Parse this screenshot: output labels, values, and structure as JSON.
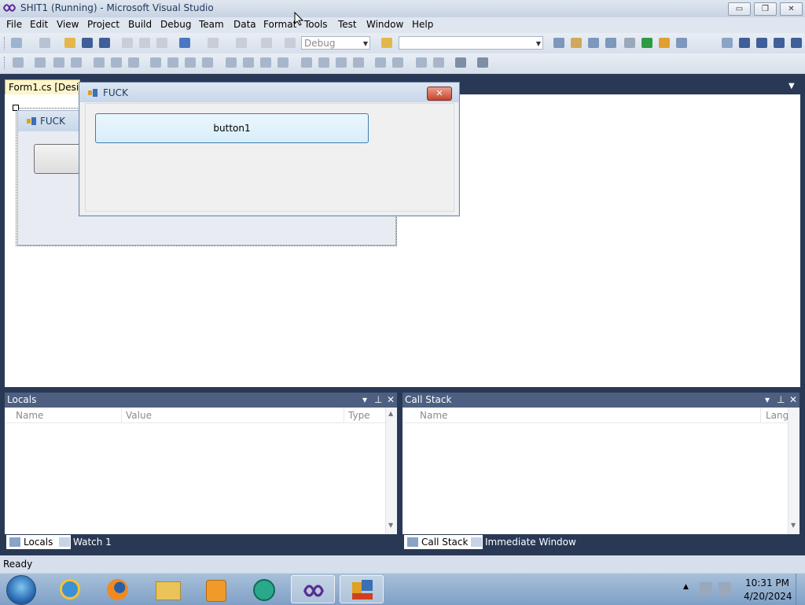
{
  "window": {
    "title": "SHIT1 (Running) - Microsoft Visual Studio",
    "min_glyph": "▭",
    "restore_glyph": "❐",
    "close_glyph": "✕"
  },
  "menu": [
    "File",
    "Edit",
    "View",
    "Project",
    "Build",
    "Debug",
    "Team",
    "Data",
    "Format",
    "Tools",
    "Test",
    "Window",
    "Help"
  ],
  "toolbar": {
    "config_value": "Debug",
    "find_value": ""
  },
  "designer": {
    "tab_label": "Form1.cs [Design]",
    "design_form_title": "FUCK"
  },
  "running_form": {
    "title": "FUCK",
    "close_glyph": "✕",
    "button_label": "button1"
  },
  "locals": {
    "title": "Locals",
    "columns": [
      "Name",
      "Value",
      "Type"
    ],
    "tabs": [
      "Locals",
      "Watch 1"
    ]
  },
  "callstack": {
    "title": "Call Stack",
    "columns": [
      "Name",
      "Lang"
    ],
    "tabs": [
      "Call Stack",
      "Immediate Window"
    ]
  },
  "toolwin_ctrl": {
    "dropdown": "▾",
    "pin": "⊥",
    "close": "✕"
  },
  "status": {
    "text": "Ready"
  },
  "taskbar": {
    "time": "10:31 PM",
    "date": "4/20/2024",
    "apps": [
      "start-orb-icon",
      "internet-explorer-icon",
      "firefox-icon",
      "file-explorer-icon",
      "media-player-icon",
      "messenger-icon",
      "visual-studio-icon",
      "windows-form-app-icon"
    ]
  },
  "colors": {
    "ide_background": "#293955",
    "toolwin_title": "#4d6082",
    "doc_tab_active": "#fff5cc"
  }
}
